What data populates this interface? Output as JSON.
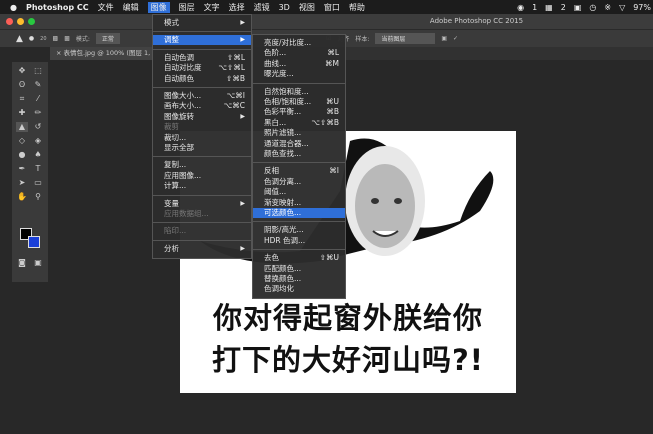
{
  "menubar": {
    "apple": "",
    "app": "Photoshop CC",
    "items": [
      "文件",
      "编辑",
      "图像",
      "图层",
      "文字",
      "选择",
      "滤镜",
      "3D",
      "视图",
      "窗口",
      "帮助"
    ],
    "status": [
      "1",
      "2",
      "97%"
    ]
  },
  "window": {
    "title": "Adobe Photoshop CC 2015"
  },
  "options": {
    "mode_label": "模式:",
    "mode_value": "正常",
    "align_label": "对齐",
    "sample_label": "样本:",
    "sample_value": "当前图层",
    "brush_size": "20"
  },
  "document_tab": "表情包.jpg @ 100% (图层 1,",
  "image_menu": [
    {
      "label": "模式",
      "submenu": true
    },
    {
      "sep": true
    },
    {
      "label": "调整",
      "submenu": true,
      "highlighted": true
    },
    {
      "sep": true
    },
    {
      "label": "自动色调",
      "shortcut": "⇧⌘L"
    },
    {
      "label": "自动对比度",
      "shortcut": "⌥⇧⌘L"
    },
    {
      "label": "自动颜色",
      "shortcut": "⇧⌘B"
    },
    {
      "sep": true
    },
    {
      "label": "图像大小...",
      "shortcut": "⌥⌘I"
    },
    {
      "label": "画布大小...",
      "shortcut": "⌥⌘C"
    },
    {
      "label": "图像旋转",
      "submenu": true
    },
    {
      "label": "裁剪",
      "disabled": true
    },
    {
      "label": "裁切..."
    },
    {
      "label": "显示全部"
    },
    {
      "sep": true
    },
    {
      "label": "复制..."
    },
    {
      "label": "应用图像..."
    },
    {
      "label": "计算..."
    },
    {
      "sep": true
    },
    {
      "label": "变量",
      "submenu": true
    },
    {
      "label": "应用数据组...",
      "disabled": true
    },
    {
      "sep": true
    },
    {
      "label": "陷印...",
      "disabled": true
    },
    {
      "sep": true
    },
    {
      "label": "分析",
      "submenu": true
    }
  ],
  "adjust_menu": [
    {
      "label": "亮度/对比度..."
    },
    {
      "label": "色阶...",
      "shortcut": "⌘L"
    },
    {
      "label": "曲线...",
      "shortcut": "⌘M"
    },
    {
      "label": "曝光度..."
    },
    {
      "sep": true
    },
    {
      "label": "自然饱和度..."
    },
    {
      "label": "色相/饱和度...",
      "shortcut": "⌘U"
    },
    {
      "label": "色彩平衡...",
      "shortcut": "⌘B"
    },
    {
      "label": "黑白...",
      "shortcut": "⌥⇧⌘B"
    },
    {
      "label": "照片滤镜..."
    },
    {
      "label": "通道混合器..."
    },
    {
      "label": "颜色查找..."
    },
    {
      "sep": true
    },
    {
      "label": "反相",
      "shortcut": "⌘I"
    },
    {
      "label": "色调分离..."
    },
    {
      "label": "阈值..."
    },
    {
      "label": "渐变映射..."
    },
    {
      "label": "可选颜色...",
      "highlighted": true
    },
    {
      "sep": true
    },
    {
      "label": "阴影/高光..."
    },
    {
      "label": "HDR 色调..."
    },
    {
      "sep": true
    },
    {
      "label": "去色",
      "shortcut": "⇧⌘U"
    },
    {
      "label": "匹配颜色..."
    },
    {
      "label": "替换颜色..."
    },
    {
      "label": "色调均化"
    }
  ],
  "meme": {
    "line1": "你对得起窗外朕给你",
    "line2": "打下的大好河山吗?!"
  },
  "colors": {
    "accent": "#2f6fd8",
    "foreground": "#000000",
    "background": "#1a3fd8"
  }
}
